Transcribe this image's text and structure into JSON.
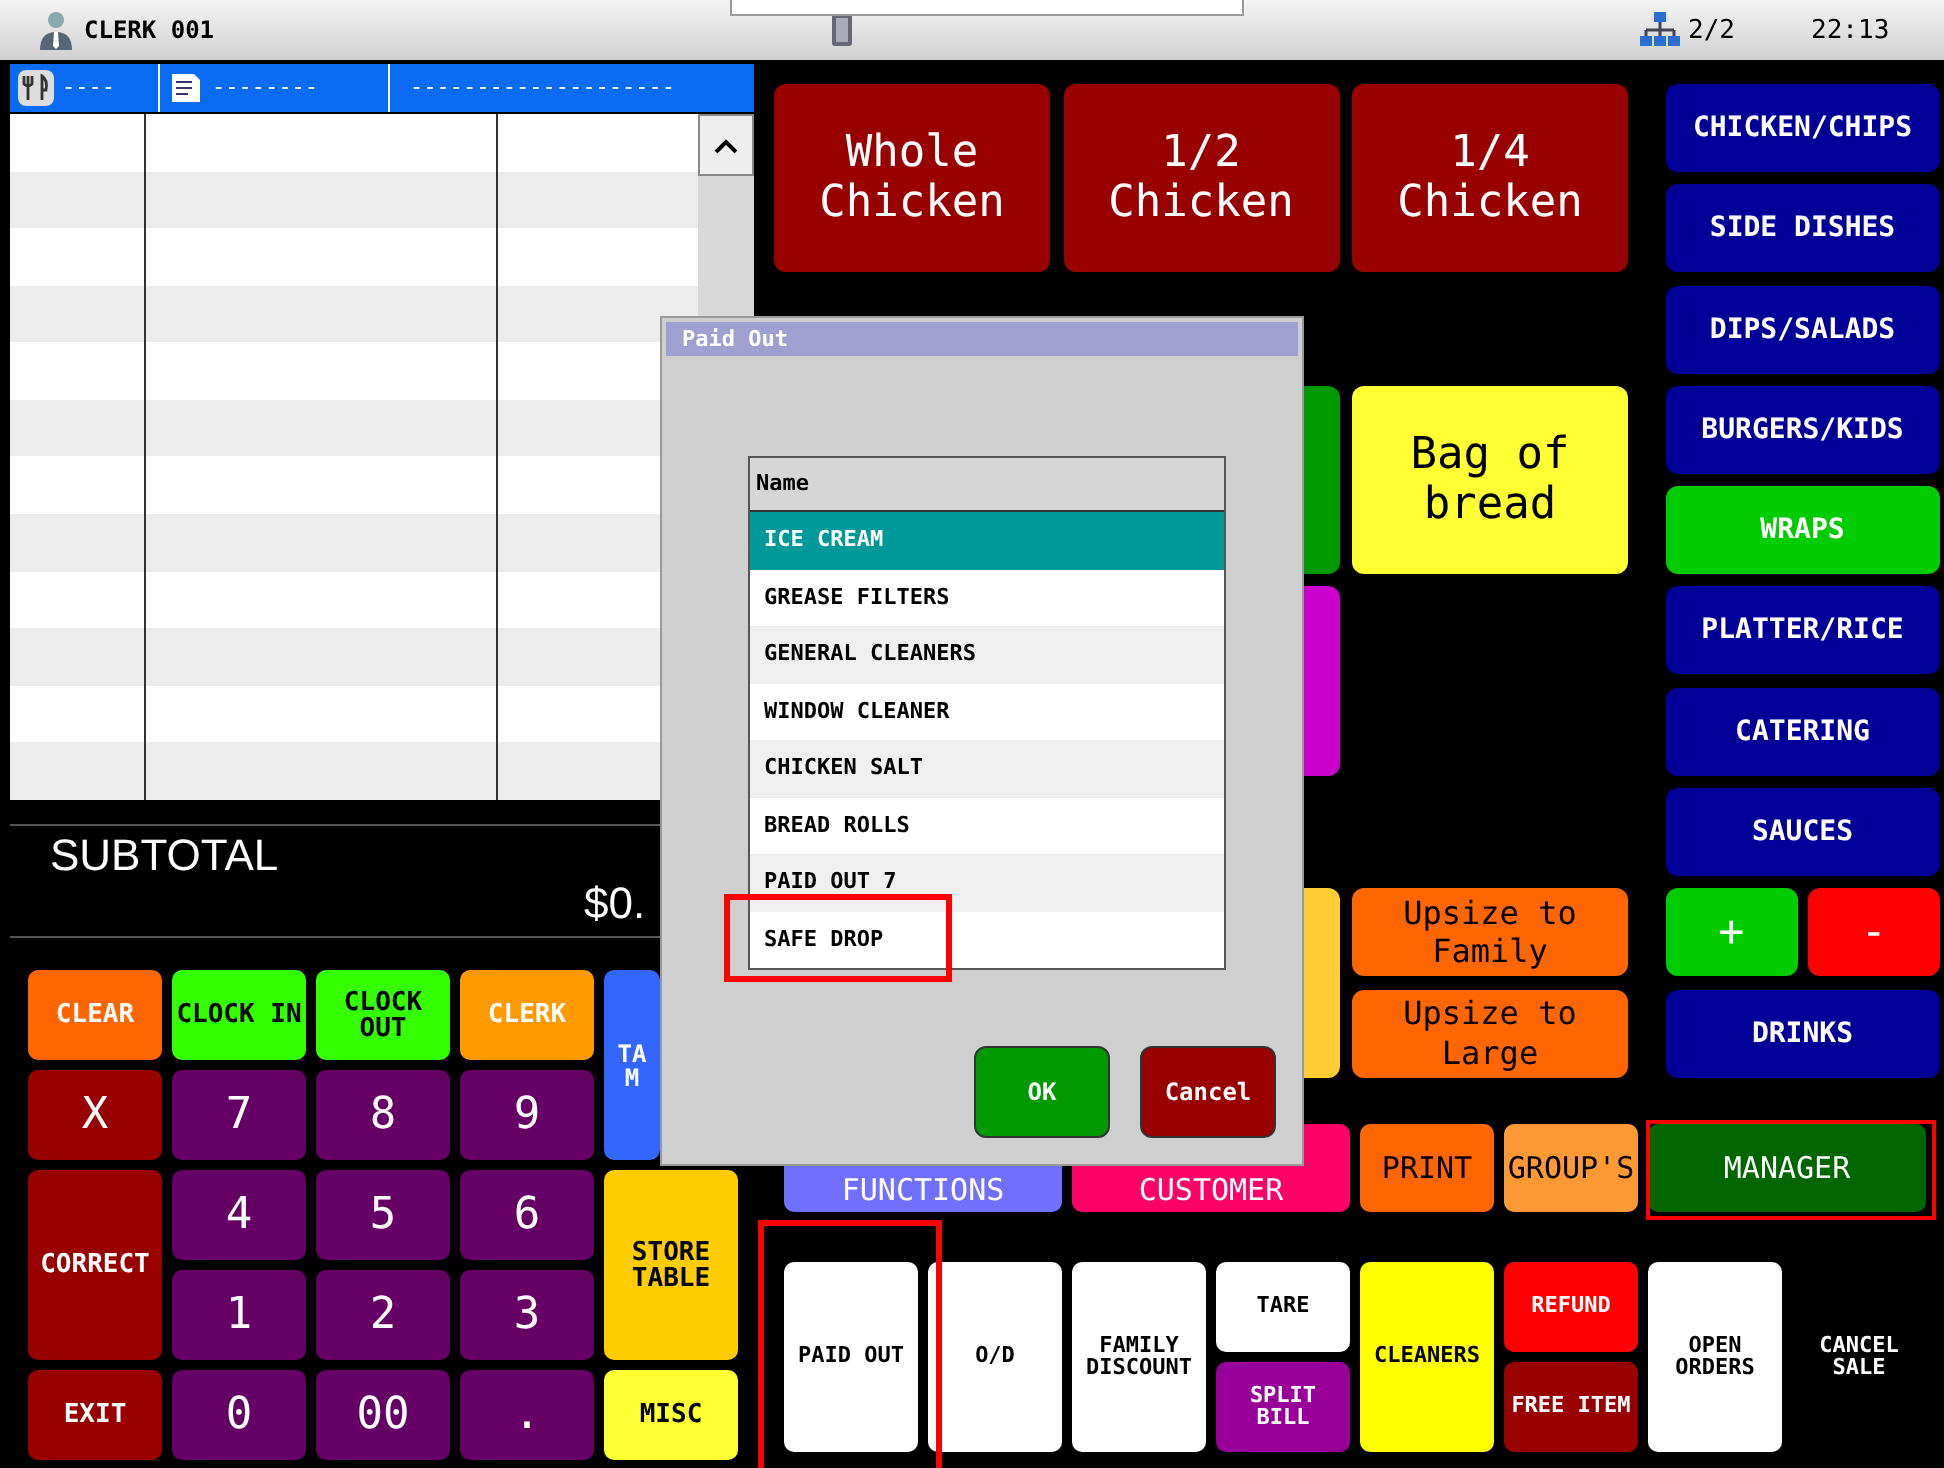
{
  "top_bar": {
    "clerk": "CLERK 001",
    "stations": "2/2",
    "time": "22:13"
  },
  "order_header": {
    "table": "----",
    "ticket": "--------",
    "customer": "--------------------"
  },
  "subtotal": {
    "label": "SUBTOTAL",
    "amount": "$0."
  },
  "keypad": [
    {
      "label": "CLEAR",
      "color": "#ff6600"
    },
    {
      "label": "CLOCK IN",
      "color": "#33ff00",
      "dark_label": true
    },
    {
      "label": "CLOCK OUT",
      "color": "#33ff00",
      "dark_label": true
    },
    {
      "label": "CLERK",
      "color": "#ff9900"
    },
    {
      "label": "TA M",
      "color": "#3366ff"
    },
    {
      "label": "X",
      "color": "#990000"
    },
    {
      "label": "7",
      "color": "#660066"
    },
    {
      "label": "8",
      "color": "#660066"
    },
    {
      "label": "9",
      "color": "#660066"
    },
    {
      "label": "CORRECT",
      "color": "#990000"
    },
    {
      "label": "4",
      "color": "#660066"
    },
    {
      "label": "5",
      "color": "#660066"
    },
    {
      "label": "6",
      "color": "#660066"
    },
    {
      "label": "STORE TABLE",
      "color": "#ffcc00",
      "dark_label": true
    },
    {
      "label": "1",
      "color": "#660066"
    },
    {
      "label": "2",
      "color": "#660066"
    },
    {
      "label": "3",
      "color": "#660066"
    },
    {
      "label": "EXIT",
      "color": "#990000"
    },
    {
      "label": "0",
      "color": "#660066"
    },
    {
      "label": "00",
      "color": "#660066"
    },
    {
      "label": ".",
      "color": "#660066"
    },
    {
      "label": "MISC",
      "color": "#ffff33",
      "dark_label": true
    }
  ],
  "products": [
    {
      "label": "Whole Chicken",
      "color": "#990000"
    },
    {
      "label": "1/2 Chicken",
      "color": "#990000"
    },
    {
      "label": "1/4 Chicken",
      "color": "#990000"
    },
    {
      "color": "#009900"
    },
    {
      "label": "Bag of bread",
      "color": "#ffff33",
      "dark_label": true
    },
    {
      "color": "#cc00cc"
    },
    {
      "color": "#ffcc33"
    },
    {
      "label": "Upsize to Family",
      "color": "#ff6600",
      "dark_label": true
    },
    {
      "label": "Upsize to Large",
      "color": "#ff6600",
      "dark_label": true
    }
  ],
  "categories": [
    {
      "label": "CHICKEN/CHIPS",
      "selected": false
    },
    {
      "label": "SIDE DISHES",
      "selected": false
    },
    {
      "label": "DIPS/SALADS",
      "selected": false
    },
    {
      "label": "BURGERS/KIDS",
      "selected": false
    },
    {
      "label": "WRAPS",
      "selected": true
    },
    {
      "label": "PLATTER/RICE",
      "selected": false
    },
    {
      "label": "CATERING",
      "selected": false
    },
    {
      "label": "SAUCES",
      "selected": false
    },
    {
      "label": "DRINKS",
      "selected": false
    }
  ],
  "quantity_buttons": [
    {
      "label": "+",
      "color": "#00cc00"
    },
    {
      "label": "-",
      "color": "#ff0000"
    }
  ],
  "function_row": [
    {
      "label": "FUNCTIONS",
      "color": "#7070ff"
    },
    {
      "label": "CUSTOMER",
      "color": "#ff0066"
    },
    {
      "label": "PRINT",
      "color": "#ff6600",
      "dark_label": true
    },
    {
      "label": "GROUP'S",
      "color": "#ff9933",
      "dark_label": true
    },
    {
      "label": "MANAGER",
      "color": "#006600"
    }
  ],
  "bottom_row": [
    {
      "label": "PAID OUT",
      "color": "#ffffff",
      "dark_label": true
    },
    {
      "label": "O/D",
      "color": "#ffffff",
      "dark_label": true
    },
    {
      "label": "FAMILY DISCOUNT",
      "color": "#ffffff",
      "dark_label": true
    },
    {
      "label": "TARE",
      "color": "#ffffff",
      "dark_label": true
    },
    {
      "label": "SPLIT BILL",
      "color": "#990099"
    },
    {
      "label": "CLEANERS",
      "color": "#ffff00",
      "dark_label": true
    },
    {
      "label": "REFUND",
      "color": "#ff0000"
    },
    {
      "label": "FREE ITEM",
      "color": "#990000"
    },
    {
      "label": "OPEN ORDERS",
      "color": "#ffffff",
      "dark_label": true
    },
    {
      "label": "CANCEL SALE"
    }
  ],
  "dialog": {
    "title": "Paid Out",
    "column": "Name",
    "items": [
      {
        "label": "ICE CREAM",
        "selected": true
      },
      {
        "label": "GREASE FILTERS",
        "selected": false
      },
      {
        "label": "GENERAL CLEANERS",
        "selected": false
      },
      {
        "label": "WINDOW CLEANER",
        "selected": false
      },
      {
        "label": "CHICKEN SALT",
        "selected": false
      },
      {
        "label": "BREAD ROLLS",
        "selected": false
      },
      {
        "label": "PAID OUT 7",
        "selected": false
      },
      {
        "label": "SAFE DROP",
        "selected": false
      }
    ],
    "buttons": [
      {
        "label": "OK",
        "color": "#009900"
      },
      {
        "label": "Cancel",
        "color": "#990000"
      }
    ]
  }
}
